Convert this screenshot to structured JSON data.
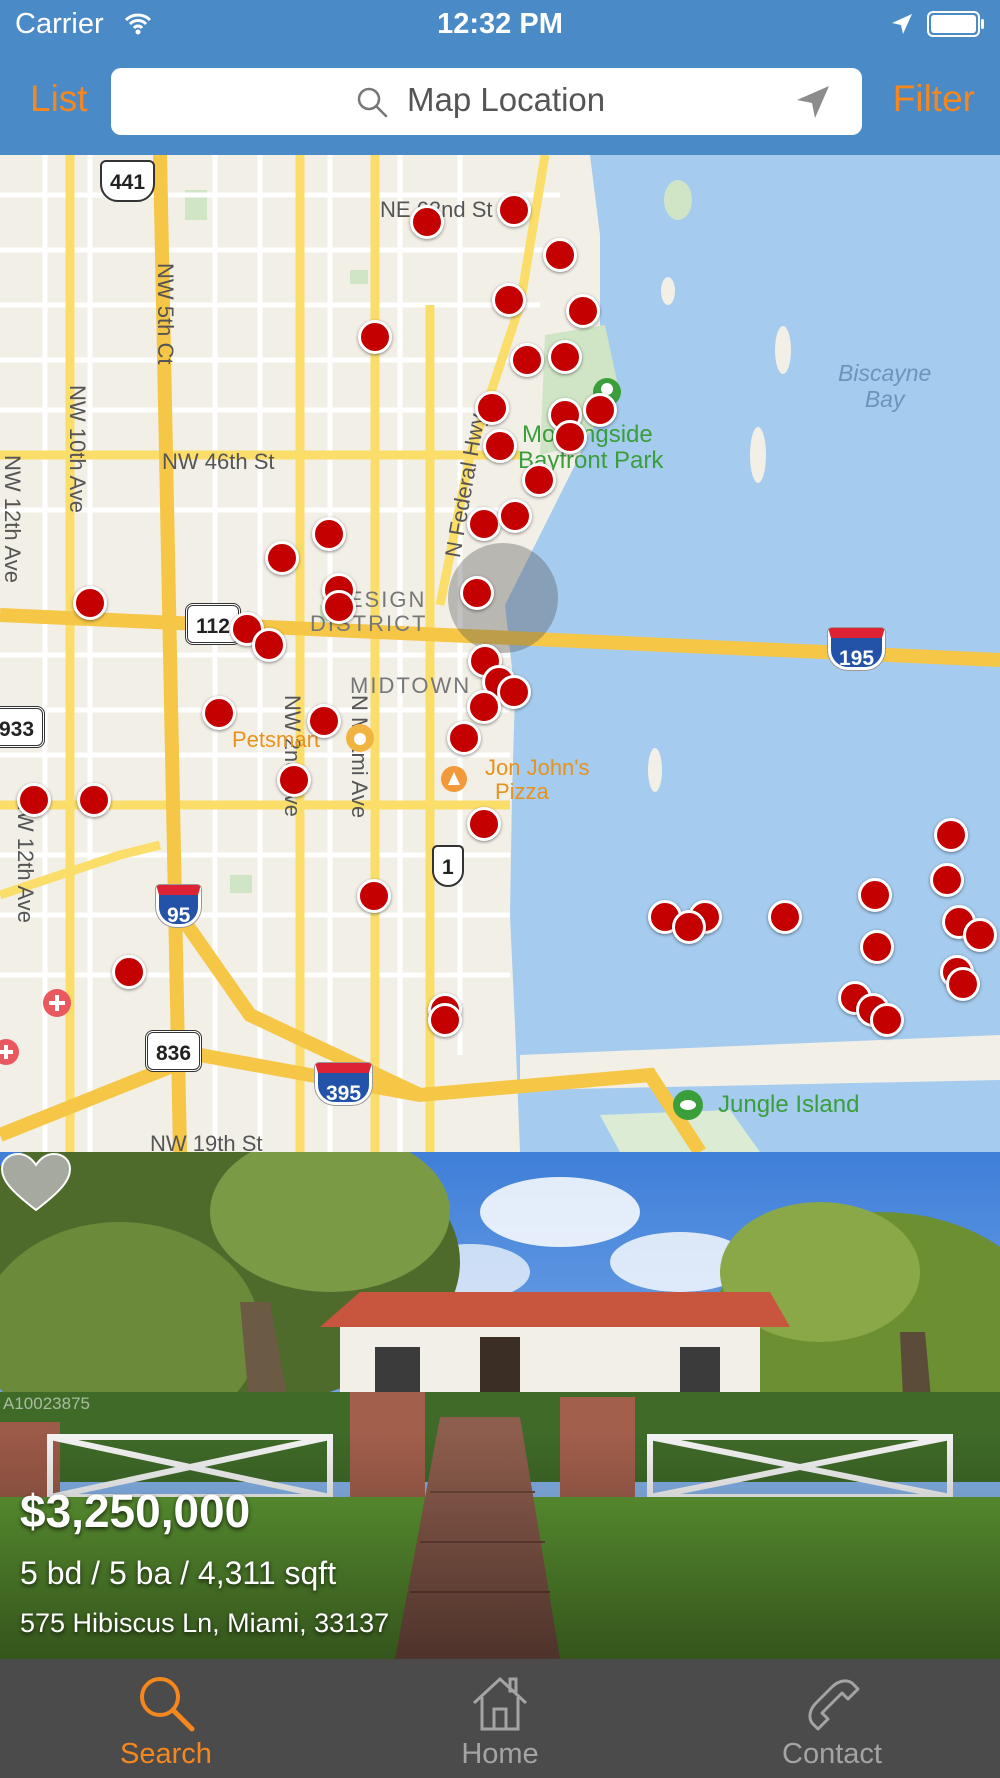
{
  "status_bar": {
    "carrier": "Carrier",
    "time": "12:32 PM"
  },
  "nav": {
    "list_label": "List",
    "filter_label": "Filter",
    "search_placeholder": "Map Location"
  },
  "map": {
    "street_labels": [
      "NE 62nd St",
      "NW 5th Ct",
      "NW 10th Ave",
      "NW 12th Ave",
      "NW 46th St",
      "N Federal Hwy",
      "NW 2nd Ave",
      "N Miami Ave",
      "NW 12th Ave",
      "NW 19th St"
    ],
    "district_labels": [
      "DESIGN",
      "DISTRICT",
      "MIDTOWN"
    ],
    "park_labels": [
      "Morningside",
      "Bayfront Park",
      "Jungle Island"
    ],
    "poi_labels": [
      "Petsmart",
      "Jon John's",
      "Pizza"
    ],
    "water_label": [
      "Biscayne",
      "Bay"
    ],
    "shields": [
      "441",
      "112",
      "195",
      "933",
      "95",
      "1",
      "836",
      "395"
    ],
    "marker_color": "#c50000"
  },
  "listing": {
    "price": "$3,250,000",
    "specs": "5 bd / 5 ba / 4,311 sqft",
    "address": "575 Hibiscus Ln, Miami, 33137",
    "mls_id": "A10023875"
  },
  "tabs": [
    {
      "label": "Search",
      "icon": "search-icon",
      "active": true
    },
    {
      "label": "Home",
      "icon": "home-icon",
      "active": false
    },
    {
      "label": "Contact",
      "icon": "phone-icon",
      "active": false
    }
  ],
  "colors": {
    "header": "#4a8ac6",
    "accent": "#f5871f",
    "tabbar": "#4b4b4b"
  }
}
